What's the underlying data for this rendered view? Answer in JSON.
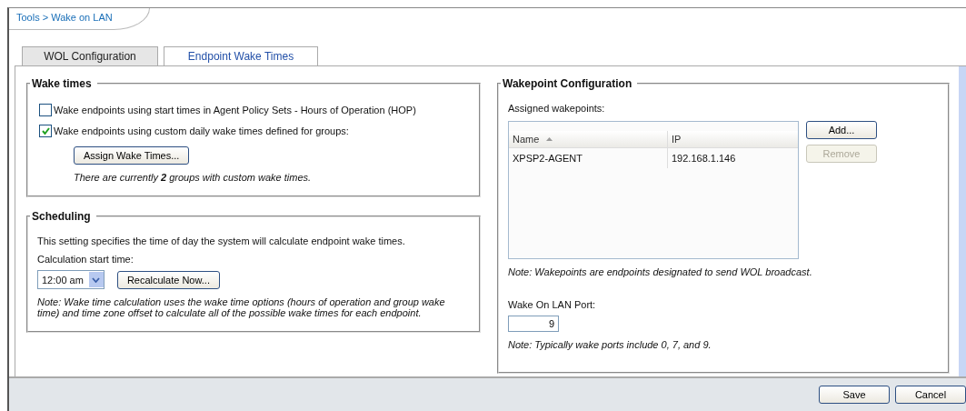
{
  "breadcrumb": "Tools > Wake on LAN",
  "tabs": [
    {
      "label": "WOL Configuration",
      "selected": false
    },
    {
      "label": "Endpoint Wake Times",
      "selected": true
    }
  ],
  "wake_times": {
    "title": "Wake times",
    "options": [
      {
        "label": "Wake endpoints using start times in Agent Policy Sets - Hours of Operation (HOP)",
        "checked": false
      },
      {
        "label": "Wake endpoints using custom daily wake times defined for groups:",
        "checked": true
      }
    ],
    "assign_button": "Assign Wake Times...",
    "note": "There are currently **2** groups with custom wake times."
  },
  "scheduling": {
    "title": "Scheduling",
    "description": "This setting specifies the time of day the system will calculate endpoint wake times.",
    "start_label": "Calculation start time:",
    "start_value": "12:00 am",
    "recalculate_button": "Recalculate Now...",
    "note": "Note: Wake time calculation uses the wake time options (hours of operation and group wake time) and time zone offset to calculate all of the possible wake times for each endpoint."
  },
  "wakepoints": {
    "title": "Wakepoint Configuration",
    "label": "Assigned wakepoints:",
    "columns": [
      {
        "label": "Name",
        "sorted": true
      },
      {
        "label": "IP",
        "sorted": false
      }
    ],
    "rows": [
      {
        "cells": [
          "XPSP2-AGENT",
          "192.168.1.146"
        ]
      }
    ],
    "buttons": [
      {
        "label": "Add...",
        "disabled": false
      },
      {
        "label": "Remove",
        "disabled": true
      }
    ],
    "note": "Note: Wakepoints are endpoints designated to send WOL broadcast.",
    "port_label": "Wake On LAN Port:",
    "port_value": "9",
    "port_note": "Note: Typically wake ports include 0, 7, and 9."
  },
  "footer_buttons": [
    "Save",
    "Cancel"
  ]
}
